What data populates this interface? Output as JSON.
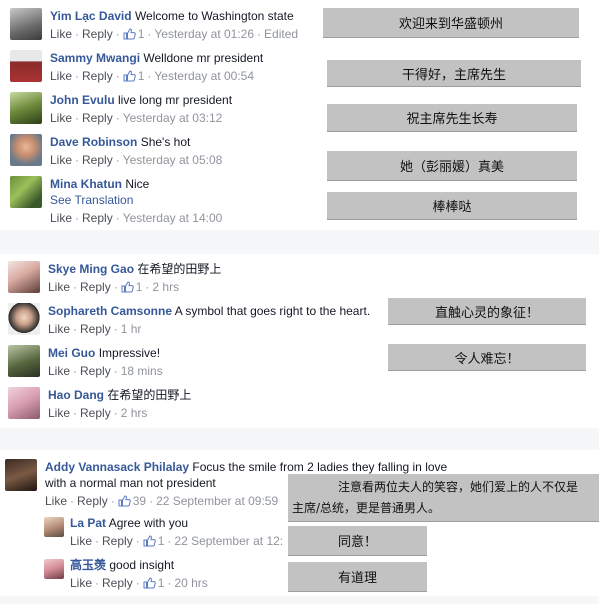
{
  "actions": {
    "like": "Like",
    "reply": "Reply",
    "see_translation": "See Translation",
    "separator": "·"
  },
  "group1": {
    "comments": [
      {
        "author": "Yim Lạc David",
        "text": "Welcome to Washington state",
        "likes": "1",
        "time": "Yesterday at 01:26",
        "edited": "Edited",
        "translation": "欢迎来到华盛顿州"
      },
      {
        "author": "Sammy Mwangi",
        "text": "Welldone mr president",
        "likes": "1",
        "time": "Yesterday at 00:54",
        "translation": "干得好，主席先生"
      },
      {
        "author": "John Evulu",
        "text": "live long mr president",
        "time": "Yesterday at 03:12",
        "translation": "祝主席先生长寿"
      },
      {
        "author": "Dave Robinson",
        "text": "She's hot",
        "time": "Yesterday at 05:08",
        "translation": "她（彭丽媛）真美"
      },
      {
        "author": "Mina Khatun",
        "text": "Nice",
        "time": "Yesterday at 14:00",
        "translation": "棒棒哒"
      }
    ]
  },
  "group2": {
    "comments": [
      {
        "author": "Skye Ming Gao",
        "text": "在希望的田野上",
        "likes": "1",
        "time": "2 hrs"
      },
      {
        "author": "Sophareth Camsonne",
        "text": "A symbol that goes right to the heart.",
        "time": "1 hr",
        "translation": "直触心灵的象征！"
      },
      {
        "author": "Mei Guo",
        "text": "Impressive!",
        "time": "18 mins",
        "translation": "令人难忘！"
      },
      {
        "author": "Hao Dang",
        "text": "在希望的田野上",
        "time": "2 hrs"
      }
    ]
  },
  "group3": {
    "main": {
      "author": "Addy Vannasack Philalay",
      "text_line1": "Focus the smile from 2 ladies they falling in love",
      "text_line2": "with a normal man not president",
      "likes": "39",
      "time": "22 September at 09:59",
      "translation_line1": "注意看两位夫人的笑容，她们爱上的人不仅是",
      "translation_line2": "主席/总统，更是普通男人。"
    },
    "replies": [
      {
        "author": "La Pat",
        "text": "Agree with you",
        "likes": "1",
        "time": "22 September at 12:",
        "translation": "同意！"
      },
      {
        "author": "高玉羡",
        "text": "good insight",
        "likes": "1",
        "time": "20 hrs",
        "translation": "有道理"
      }
    ]
  },
  "colors": {
    "author": "#365899",
    "meta": "#90949c",
    "translation_box": "#c2c2c2",
    "gap": "#f6f7f9"
  }
}
